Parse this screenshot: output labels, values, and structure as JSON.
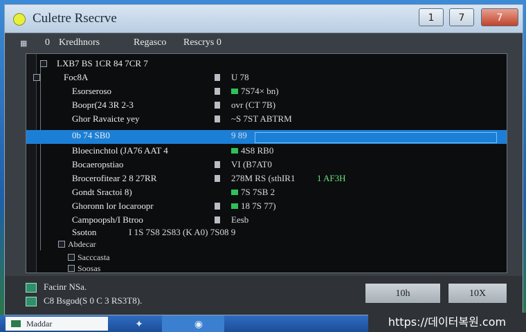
{
  "window": {
    "title": "Culetre Rsecrve",
    "min_label": "1",
    "max_label": "7",
    "close_label": "7"
  },
  "menubar": {
    "items": [
      "Kredhnors",
      "Regasco",
      "Rescrys 0"
    ],
    "lead_glyph": "0"
  },
  "tree": {
    "header_label": "LXB7 BS 1CR 84 7CR 7",
    "rows": [
      {
        "name": "Foc8A",
        "value": "U 78",
        "extra": ""
      },
      {
        "name": "Esorseroso",
        "value": "7S74× bn)",
        "extra": ""
      },
      {
        "name": "Boopr(24 3R 2-3",
        "value": "ovr (CT 7B)",
        "extra": ""
      },
      {
        "name": "Ghor Ravaicte yey",
        "value": "~S 7ST ABTRM",
        "extra": ""
      },
      {
        "name": "0b 74 SB0",
        "value": "9 89",
        "extra": "",
        "selected": true
      },
      {
        "name": "Bloecinchtol (JA76 AAT 4",
        "value": "4S8 RB0",
        "extra": ""
      },
      {
        "name": "Bocaeropstiao",
        "value": "VI (B7AT0",
        "extra": ""
      },
      {
        "name": "Brocerofitear 2 8 27RR",
        "value": "278M RS (sthIR1",
        "extra": "1 AF3H"
      },
      {
        "name": "Gondt Sractoi 8)",
        "value": "7S 7SB 2",
        "extra": ""
      },
      {
        "name": "Ghoronn lor Iocaroopr",
        "value": "18 7S 77)",
        "extra": ""
      },
      {
        "name": "Campoopsh/I Btroo",
        "value": "Eesb",
        "extra": ""
      },
      {
        "name": "Ssoton",
        "value": "I 1S 7S8 2S83 (K A0) 7S08 9",
        "extra": ""
      }
    ],
    "children": [
      "Abdecar",
      "Sacccasta",
      "Soosas"
    ]
  },
  "status": {
    "line1": "Facinr NSa.",
    "line2": "C8 Bsgod(S 0 C 3 RS3T8)."
  },
  "buttons": {
    "ok": "10h",
    "cancel": "10X"
  },
  "taskbar": {
    "start_label": "Maddar",
    "icons": [
      "bird-icon",
      "blue-dome-icon"
    ]
  },
  "watermark": "https://데이터복원.com",
  "colors": {
    "selection": "#1b7fd6",
    "panel_bg": "#0c0d0f",
    "accent_green": "#2fc05a"
  }
}
